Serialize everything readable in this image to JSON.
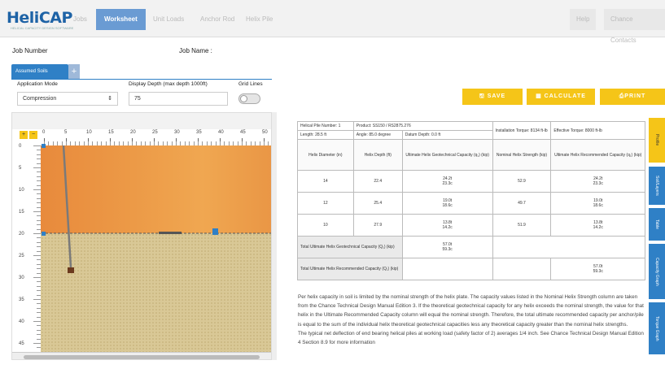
{
  "app": {
    "logo": "HeliCAP",
    "logo_sub": "HELICAL CAPACITY DESIGN SOFTWARE"
  },
  "nav": {
    "tabs": [
      "Jobs",
      "Worksheet",
      "Unit Loads",
      "Anchor Rod",
      "Helix Pile"
    ],
    "active": "Worksheet",
    "right": [
      "Help",
      "Chance Contacts"
    ]
  },
  "job": {
    "number_label": "Job Number",
    "name_label": "Job Name :"
  },
  "soil_tab": {
    "label": "Assumed Soils",
    "add": "+"
  },
  "controls": {
    "mode_label": "Application Mode",
    "mode_value": "Compression",
    "depth_label": "Display Depth (max depth 1000ft)",
    "depth_value": "75",
    "grid_label": "Grid Lines"
  },
  "buttons": {
    "save": "SAVE",
    "calculate": "CALCULATE",
    "print": "PRINT"
  },
  "canvas": {
    "x_ticks": [
      "0",
      "5",
      "10",
      "15",
      "20",
      "25",
      "30",
      "35",
      "40",
      "45",
      "50"
    ],
    "y_ticks": [
      "0",
      "5",
      "10",
      "15",
      "20",
      "25",
      "30",
      "35",
      "40",
      "45"
    ]
  },
  "table": {
    "pile_number": "Helical Pile Number: 1",
    "product": "Product: SS150 / RS2875.276",
    "install_torque": "Installation Torque: 8134 ft-lb",
    "effective_torque": "Effective Torque: 8000 ft-lb",
    "length": "Length: 28.5 ft",
    "angle": "Angle: 85.0 degree",
    "datum": "Datum Depth: 0.0 ft",
    "col_helix_dia": "Helix Diameter (in)",
    "col_helix_depth": "Helix Depth (ft)",
    "col_ult_geo": "Ultimate Helix Geotechnical Capacity (q₁) (kip)",
    "col_nominal": "Nominal Helix Strength (kip)",
    "col_rec": "Ultimate Helix Recommended Capacity (q₁) (kip)",
    "rows": [
      {
        "dia": "14",
        "depth": "22.4",
        "geo_t": "24.2t",
        "geo_c": "23.3c",
        "nominal": "52.9",
        "rec_t": "24.2t",
        "rec_c": "23.3c"
      },
      {
        "dia": "12",
        "depth": "25.4",
        "geo_t": "19.0t",
        "geo_c": "18.6c",
        "nominal": "49.7",
        "rec_t": "19.0t",
        "rec_c": "18.6c"
      },
      {
        "dia": "10",
        "depth": "27.9",
        "geo_t": "13.8t",
        "geo_c": "14.2c",
        "nominal": "51.9",
        "rec_t": "13.8t",
        "rec_c": "14.2c"
      }
    ],
    "total_geo_label": "Total Ultimate Helix Geotechnical Capacity (Q₁) (kip)",
    "total_geo_t": "57.0t",
    "total_geo_c": "59.3c",
    "total_rec_label": "Total Ultimate Helix Recommended Capacity (Q₁) (kip)",
    "total_rec_t": "57.0t",
    "total_rec_c": "59.3c"
  },
  "notes": {
    "p1": "Per helix capacity in soil is limited by the nominal strength of the helix plate. The capacity values listed in the Nominal Helix Strength column are taken from the Chance Technical Design Manual Edition 3. If the theoretical geotechnical capacity for any helix exceeds the nominal strength, the value for that helix in the Ultimate Recommended Capacity column will equal the nominal strength. Therefore, the total ultimate recommended capacity per anchor/pile is equal to the sum of the individual helix theoretical geotechnical capacities less any theoretical capacity greater than the nominal helix strengths.",
    "p2": "The typical net deflection of end bearing helical piles at working load (safety factor of 2) averages 1/4 inch. See Chance Technical Design Manual Edition 4 Section 8.9 for more information"
  },
  "side_tabs": [
    "Profile",
    "Soil/Layers",
    "Table",
    "Capacity Graph",
    "Torque Graph"
  ]
}
